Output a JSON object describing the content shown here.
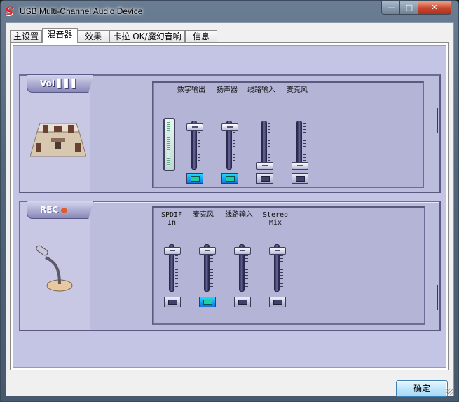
{
  "window": {
    "title": "USB Multi-Channel Audio Device",
    "logo_letter": "S",
    "min_glyph": "—",
    "max_glyph": "□",
    "close_glyph": "✕"
  },
  "tabs": [
    {
      "label": "主设置"
    },
    {
      "label": "混音器",
      "active": true
    },
    {
      "label": "效果"
    },
    {
      "label": "卡拉 OK/魔幻音响"
    },
    {
      "label": "信息"
    }
  ],
  "playback": {
    "badge": "Vol",
    "badge_bars": "▌▌▌",
    "channels": [
      {
        "label": "数字输出",
        "level": 0.93,
        "muted": true
      },
      {
        "label": "扬声器",
        "level": 0.93,
        "muted": true
      },
      {
        "label": "线路输入",
        "level": 0.0,
        "muted": false
      },
      {
        "label": "麦克风",
        "level": 0.0,
        "muted": false
      }
    ]
  },
  "record": {
    "badge": "REC",
    "channels": [
      {
        "label": "SPDIF\nIn",
        "level": 0.93,
        "muted": false
      },
      {
        "label": "麦克风",
        "level": 0.93,
        "muted": true
      },
      {
        "label": "线路输入",
        "level": 0.93,
        "muted": false
      },
      {
        "label": "Stereo\nMix",
        "level": 0.93,
        "muted": false
      }
    ]
  },
  "footer": {
    "ok_label": "确定"
  },
  "colors": {
    "panel": "#c4c4e4",
    "group": "#bcbcdc",
    "mute_on": "#1a70e0"
  }
}
